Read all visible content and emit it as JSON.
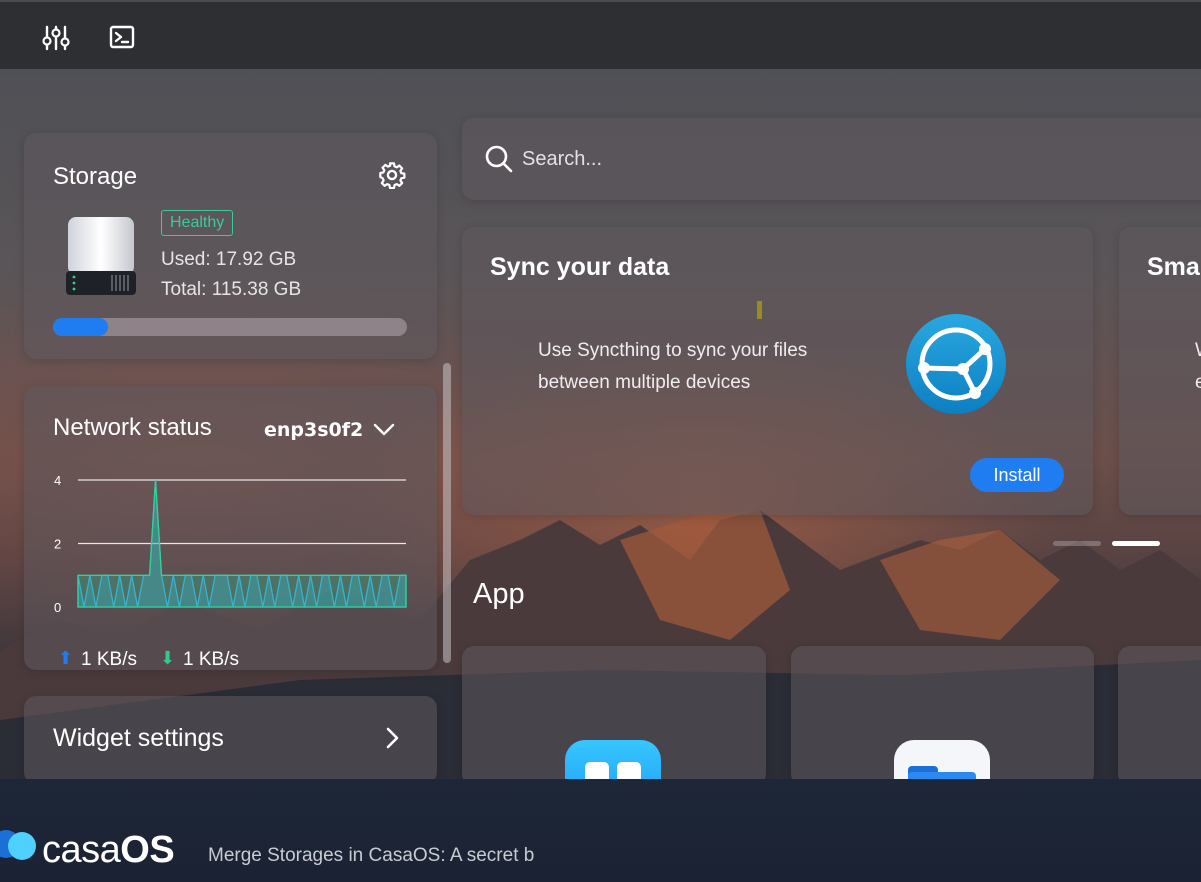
{
  "topbar": {
    "icons": [
      "settings-sliders-icon",
      "terminal-icon"
    ]
  },
  "storage": {
    "title": "Storage",
    "status": "Healthy",
    "used": "Used: 17.92 GB",
    "total": "Total: 115.38 GB",
    "usage_fraction": 0.155,
    "colors": {
      "bar": "#1f7df1",
      "healthy": "#3fc89a"
    }
  },
  "network": {
    "title": "Network status",
    "interface": "enp3s0f2",
    "upload": "1 KB/s",
    "download": "1 KB/s",
    "chart_data": {
      "type": "area",
      "y_ticks": [
        "4",
        "2",
        "0"
      ],
      "ylim": [
        0,
        4
      ],
      "grid": true,
      "series": [
        {
          "values": [
            1,
            0,
            1,
            0,
            1,
            1,
            0,
            1,
            0,
            1,
            0,
            1,
            1,
            4,
            1,
            0,
            1,
            0,
            1,
            1,
            0,
            1,
            0,
            1,
            1,
            1,
            0,
            1,
            0,
            1,
            1,
            0,
            1,
            0,
            1,
            1,
            0,
            1,
            0,
            1,
            0,
            1,
            1,
            0,
            1,
            0,
            1,
            1,
            0,
            1,
            0,
            1,
            1,
            0,
            1,
            1
          ]
        },
        {
          "values": [
            1,
            1,
            1,
            1,
            1,
            1,
            1,
            1,
            1,
            1,
            1,
            1,
            1,
            4,
            1,
            1,
            1,
            1,
            1,
            1,
            1,
            1,
            1,
            1,
            1,
            1,
            1,
            1,
            1,
            1,
            1,
            1,
            1,
            1,
            1,
            1,
            1,
            1,
            1,
            1,
            1,
            1,
            1,
            1,
            1,
            1,
            1,
            1,
            1,
            1,
            1,
            1,
            1,
            1,
            1,
            1
          ]
        }
      ]
    }
  },
  "widget_settings": {
    "label": "Widget settings"
  },
  "search": {
    "placeholder": "Search..."
  },
  "sync_card": {
    "title": "Sync your data",
    "description": "Use Syncthing to sync your files between multiple devices",
    "button": "Install"
  },
  "next_card": {
    "title": "Sma",
    "text_line1": "W",
    "text_line2": "e"
  },
  "app_section": {
    "heading": "App"
  },
  "footer": {
    "logo_light": "casa",
    "logo_bold": "OS",
    "news": "Merge Storages in CasaOS: A secret b"
  }
}
